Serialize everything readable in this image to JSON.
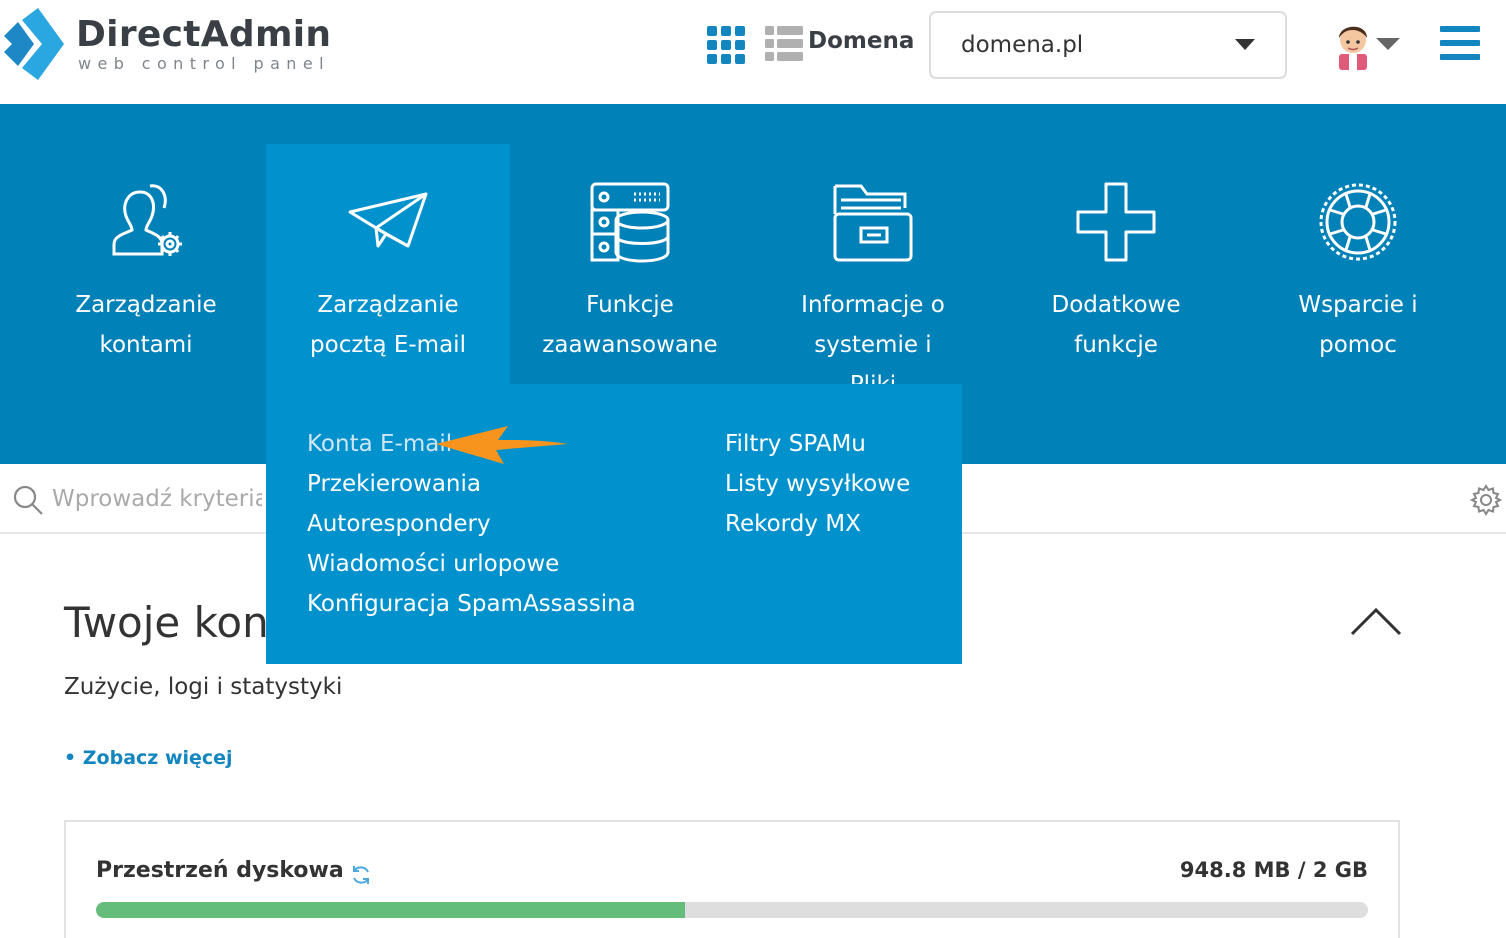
{
  "header": {
    "logo_name": "DirectAdmin",
    "logo_subtitle": "web control panel",
    "domain_label": "Domena",
    "domain_value": "domena.pl",
    "icons": [
      "apps-grid-icon",
      "list-icon",
      "avatar-icon",
      "hamburger-menu-icon"
    ]
  },
  "nav": {
    "items": [
      {
        "label": "Zarządzanie kontami",
        "icon": "users-gear-icon"
      },
      {
        "label": "Zarządzanie pocztą E-mail",
        "icon": "paper-plane-icon",
        "active": true
      },
      {
        "label": "Funkcje zaawansowane",
        "icon": "server-database-icon"
      },
      {
        "label": "Informacje o systemie i Pliki",
        "icon": "folder-icon"
      },
      {
        "label": "Dodatkowe funkcje",
        "icon": "plus-icon"
      },
      {
        "label": "Wsparcie i pomoc",
        "icon": "lifebuoy-icon"
      }
    ]
  },
  "dropdown": {
    "left": [
      "Konta E-mail",
      "Przekierowania",
      "Autorespondery",
      "Wiadomości urlopowe",
      "Konfiguracja SpamAssassina"
    ],
    "right": [
      "Filtry SPAMu",
      "Listy wysyłkowe",
      "Rekordy MX"
    ]
  },
  "search": {
    "placeholder": "Wprowadź kryteria"
  },
  "main": {
    "title": "Twoje kon",
    "subtitle": "Zużycie, logi i statystyki",
    "see_more": "• Zobacz więcej"
  },
  "disk": {
    "title": "Przestrzeń dyskowa",
    "value": "948.8 MB / 2 GB",
    "used_fraction": 0.4633
  },
  "colors": {
    "nav_bg": "#0081b8",
    "nav_active": "#0191cd",
    "accent": "#1386c0",
    "arrow": "#f7941d",
    "progress": "#65bd7b"
  }
}
